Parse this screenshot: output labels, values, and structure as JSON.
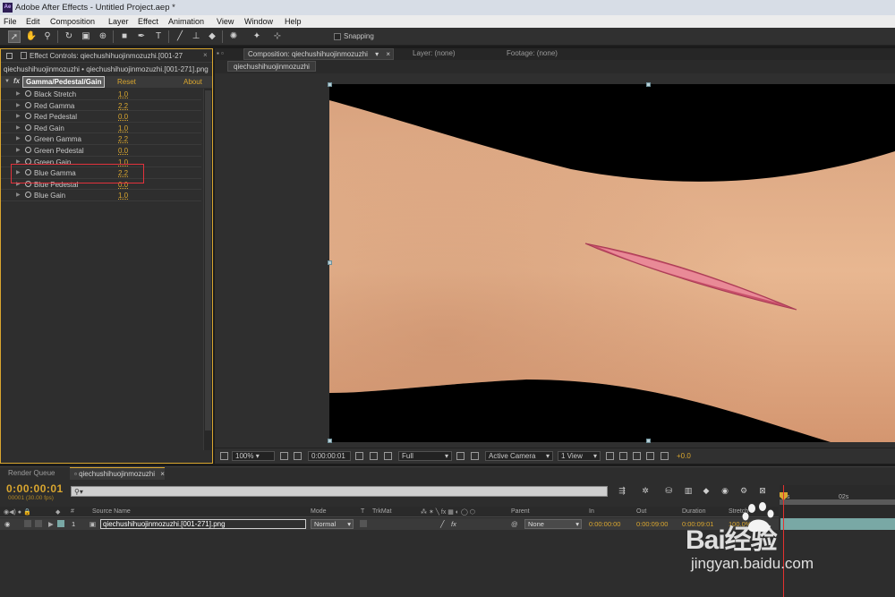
{
  "window": {
    "title": "Adobe After Effects - Untitled Project.aep *",
    "logo_text": "Ae"
  },
  "menu": [
    "File",
    "Edit",
    "Composition",
    "Layer",
    "Effect",
    "Animation",
    "View",
    "Window",
    "Help"
  ],
  "toolbar": {
    "tools": [
      "selection-tool",
      "hand-tool",
      "zoom-tool",
      "rotation-tool",
      "camera-orbit-tool",
      "pan-behind-tool",
      "rectangle-tool",
      "pen-tool",
      "type-tool",
      "brush-tool",
      "clone-stamp-tool",
      "eraser-tool",
      "roto-brush-tool",
      "puppet-pin-tool"
    ],
    "snapping_label": "Snapping"
  },
  "effect_controls": {
    "tab_label": "Effect Controls: qiechushihuojinmozuzhi.[001-27",
    "layer_path": "qiechushihuojinmozuzhi • qiechushihuojinmozuzhi.[001-271].png",
    "effect_badge": "fx",
    "effect_name": "Gamma/Pedestal/Gain",
    "reset_label": "Reset",
    "about_label": "About",
    "params": [
      {
        "name": "Black Stretch",
        "value": "1.0"
      },
      {
        "name": "Red Gamma",
        "value": "2.2"
      },
      {
        "name": "Red Pedestal",
        "value": "0.0"
      },
      {
        "name": "Red Gain",
        "value": "1.0"
      },
      {
        "name": "Green Gamma",
        "value": "2.2"
      },
      {
        "name": "Green Pedestal",
        "value": "0.0"
      },
      {
        "name": "Green Gain",
        "value": "1.0"
      },
      {
        "name": "Blue Gamma",
        "value": "2.2"
      },
      {
        "name": "Blue Pedestal",
        "value": "0.0"
      },
      {
        "name": "Blue Gain",
        "value": "1.0"
      }
    ],
    "highlighted_param": "Blue Gamma",
    "highlight_color": "#e2323c"
  },
  "composition": {
    "tab_label": "Composition: qiechushihuojinmozuzhi",
    "layer_tab": "Layer: (none)",
    "footage_tab": "Footage: (none)",
    "subtab": "qiechushihuojinmozuzhi",
    "bottom_bar": {
      "zoom": "100%",
      "timecode": "0:00:00:01",
      "resolution": "Full",
      "camera": "Active Camera",
      "views": "1 View",
      "exposure": "+0.0"
    }
  },
  "timeline": {
    "render_queue_tab": "Render Queue",
    "comp_tab": "qiechushihuojinmozuzhi",
    "timecode": "0:00:00:01",
    "fps": "00001 (30.00 fps)",
    "search_placeholder": "",
    "columns": {
      "hash": "#",
      "source_name": "Source Name",
      "mode": "Mode",
      "t": "T",
      "trkmat": "TrkMat",
      "parent": "Parent",
      "in": "In",
      "out": "Out",
      "duration": "Duration",
      "stretch": "Stretch"
    },
    "layer": {
      "index": "1",
      "name": "qiechushihuojinmozuzhi.[001-271].png",
      "mode": "Normal",
      "parent": "None",
      "in": "0:00:00:00",
      "out": "0:00:09:00",
      "duration": "0:00:09:01",
      "stretch": "100.0%"
    },
    "ruler": {
      "start_label": "0s",
      "mark_label": "02s"
    },
    "accent_color": "#d9a62f",
    "layer_bar_color": "#79a8a5"
  },
  "watermark": {
    "brand": "Bai经验",
    "url": "jingyan.baidu.com"
  }
}
